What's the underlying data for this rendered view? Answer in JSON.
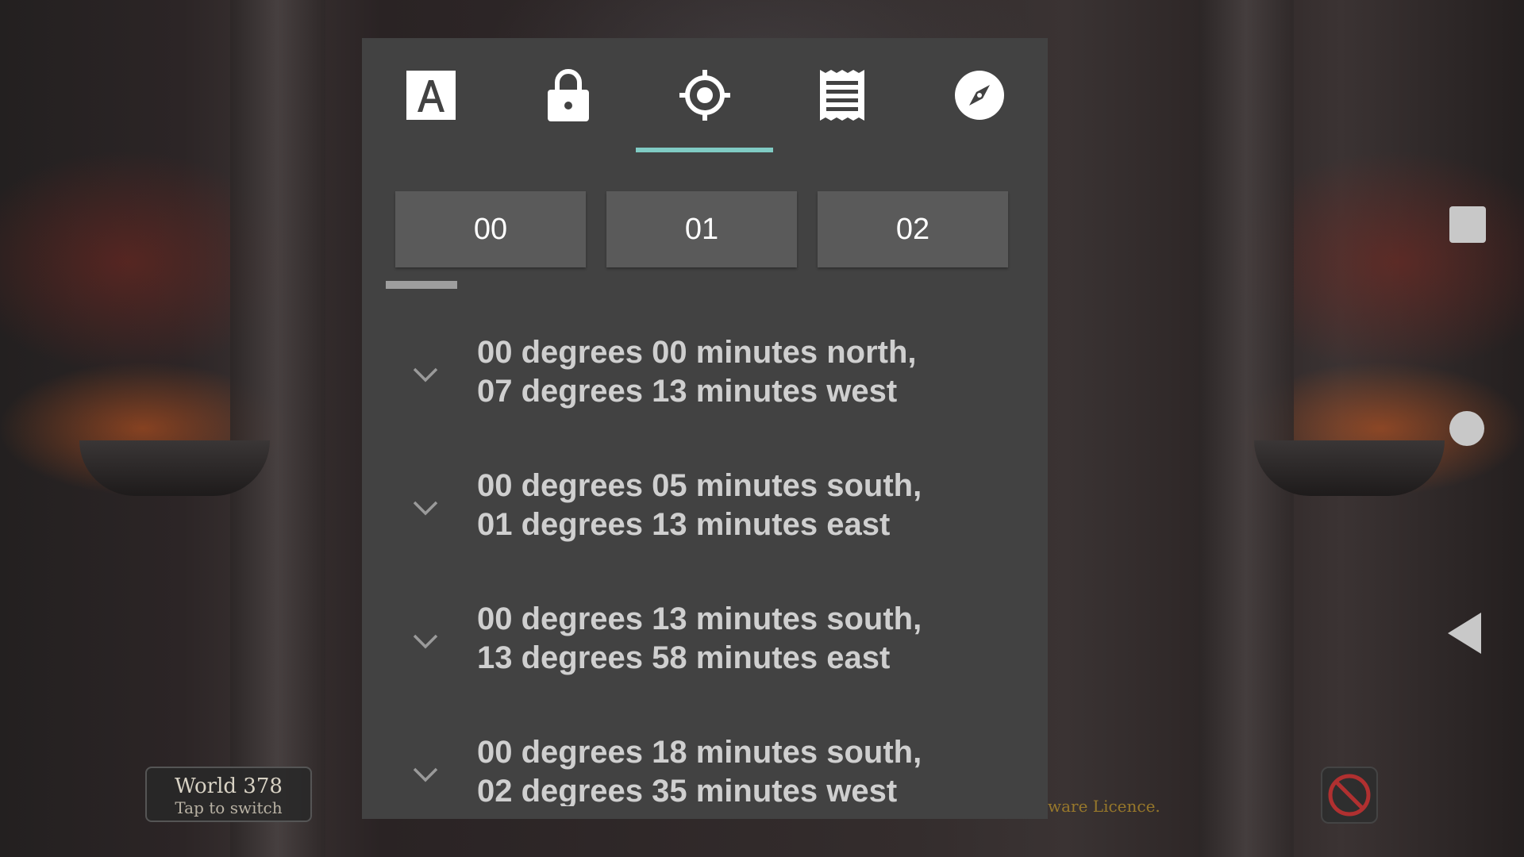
{
  "background": {
    "world_badge": {
      "title": "World 378",
      "subtitle": "Tap to switch"
    },
    "licence_text": "ware Licence.",
    "sound_icon": "muted-speaker-icon"
  },
  "navigation": {
    "square": "recent-apps-icon",
    "circle": "home-icon",
    "back": "back-icon"
  },
  "panel": {
    "tabs": [
      {
        "icon": "text-a-icon"
      },
      {
        "icon": "lock-icon"
      },
      {
        "icon": "crosshair-icon",
        "selected": true
      },
      {
        "icon": "receipt-icon"
      },
      {
        "icon": "compass-icon"
      }
    ],
    "accent_color": "#80cbc4",
    "chips": [
      {
        "label": "00",
        "selected": true
      },
      {
        "label": "01"
      },
      {
        "label": "02"
      }
    ],
    "items": [
      {
        "line1": "00 degrees 00 minutes north,",
        "line2": "07 degrees 13 minutes west"
      },
      {
        "line1": "00 degrees 05 minutes south,",
        "line2": "01 degrees 13 minutes east"
      },
      {
        "line1": "00 degrees 13 minutes south,",
        "line2": "13 degrees 58 minutes east"
      },
      {
        "line1": "00 degrees 18 minutes south,",
        "line2": "02 degrees 35 minutes west"
      }
    ]
  }
}
